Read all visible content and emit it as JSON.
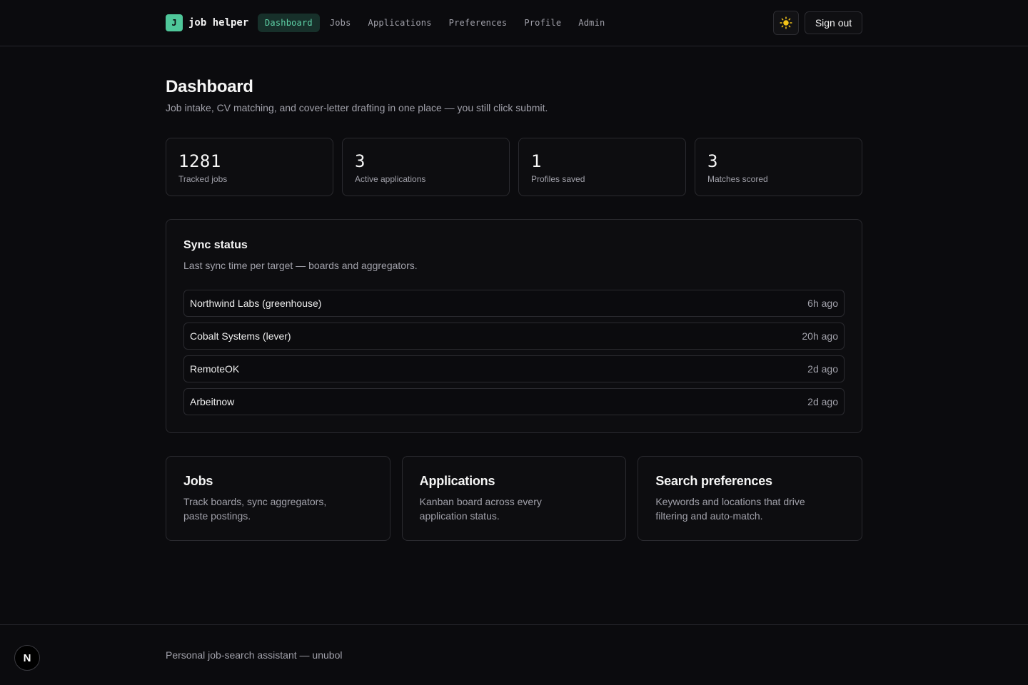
{
  "header": {
    "logo_letter": "J",
    "app_name": "job helper",
    "nav": [
      {
        "label": "Dashboard",
        "active": true
      },
      {
        "label": "Jobs"
      },
      {
        "label": "Applications"
      },
      {
        "label": "Preferences"
      },
      {
        "label": "Profile"
      },
      {
        "label": "Admin"
      }
    ],
    "theme_icon": "sun-icon",
    "signout_label": "Sign out"
  },
  "page": {
    "title": "Dashboard",
    "subtitle": "Job intake, CV matching, and cover-letter drafting in one place — you still click submit."
  },
  "stats": [
    {
      "value": "1281",
      "label": "Tracked jobs"
    },
    {
      "value": "3",
      "label": "Active applications"
    },
    {
      "value": "1",
      "label": "Profiles saved"
    },
    {
      "value": "3",
      "label": "Matches scored"
    }
  ],
  "sync": {
    "title": "Sync status",
    "subtitle": "Last sync time per target — boards and aggregators.",
    "rows": [
      {
        "name": "Northwind Labs (greenhouse)",
        "time": "6h ago"
      },
      {
        "name": "Cobalt Systems (lever)",
        "time": "20h ago"
      },
      {
        "name": "RemoteOK",
        "time": "2d ago"
      },
      {
        "name": "Arbeitnow",
        "time": "2d ago"
      }
    ]
  },
  "cards": [
    {
      "title": "Jobs",
      "desc": "Track boards, sync aggregators, paste postings."
    },
    {
      "title": "Applications",
      "desc": "Kanban board across every application status."
    },
    {
      "title": "Search preferences",
      "desc": "Keywords and locations that drive filtering and auto-match."
    }
  ],
  "footer": {
    "text": "Personal job-search assistant — unubol",
    "badge_letter": "N"
  },
  "colors": {
    "background": "#0b0b0e",
    "accent": "#4fc79a",
    "nav_active_bg": "#17302a",
    "border": "#2a2a2f",
    "muted_text": "#a1a1aa"
  }
}
